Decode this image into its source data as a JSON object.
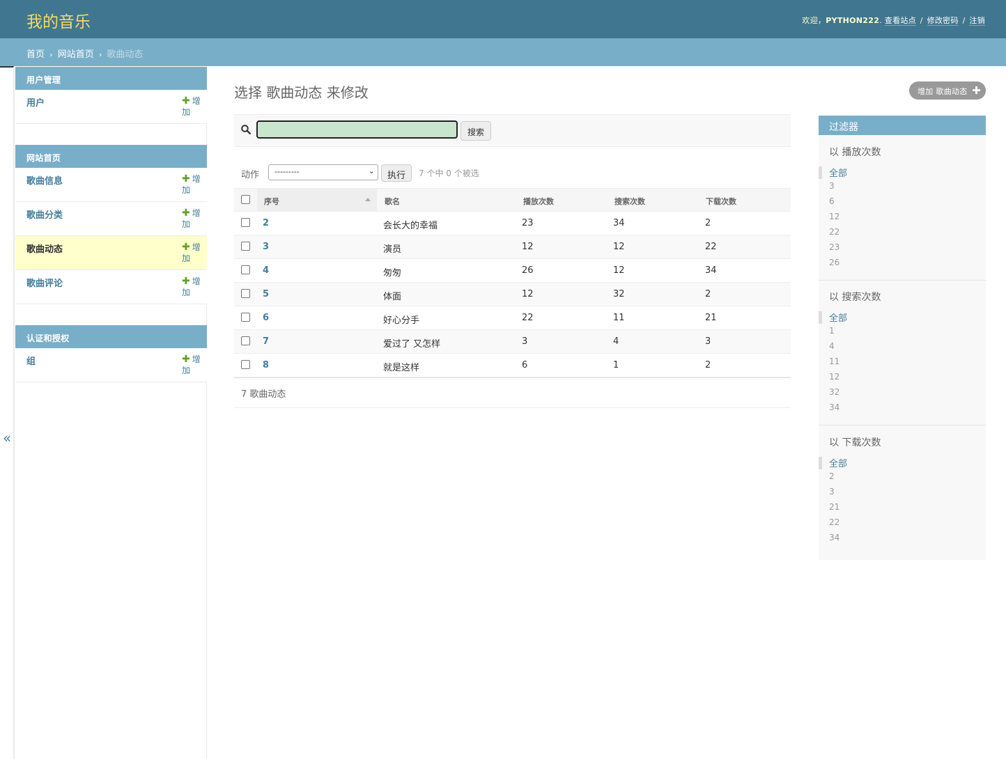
{
  "header": {
    "brand": "我的音乐",
    "welcome": "欢迎，",
    "username": "PYTHON222",
    "period": ".",
    "view_site": "查看站点",
    "change_password": "修改密码",
    "logout": "注销",
    "separator": "/"
  },
  "breadcrumbs": {
    "home": "首页",
    "app": "网站首页",
    "current": "歌曲动态",
    "sep": "›"
  },
  "sidebar": {
    "toggle": "«",
    "add_label": "增加",
    "modules": [
      {
        "caption": "用户管理",
        "items": [
          {
            "label": "用户"
          }
        ]
      },
      {
        "caption": "网站首页",
        "items": [
          {
            "label": "歌曲信息"
          },
          {
            "label": "歌曲分类"
          },
          {
            "label": "歌曲动态"
          },
          {
            "label": "歌曲评论"
          }
        ]
      },
      {
        "caption": "认证和授权",
        "items": [
          {
            "label": "组"
          }
        ]
      }
    ]
  },
  "main": {
    "title": "选择 歌曲动态 来修改",
    "add_button": "增加 歌曲动态",
    "search_value": "",
    "search_button": "搜索",
    "action_label": "动作",
    "action_selected": "---------",
    "go_button": "执行",
    "action_counter": "7 个中 0 个被选",
    "columns": [
      "序号",
      "歌名",
      "播放次数",
      "搜索次数",
      "下载次数"
    ],
    "rows": [
      {
        "id": "2",
        "name": "会长大的幸福",
        "plays": "23",
        "searches": "34",
        "downloads": "2"
      },
      {
        "id": "3",
        "name": "演员",
        "plays": "12",
        "searches": "12",
        "downloads": "22"
      },
      {
        "id": "4",
        "name": "匆匆",
        "plays": "26",
        "searches": "12",
        "downloads": "34"
      },
      {
        "id": "5",
        "name": "体面",
        "plays": "12",
        "searches": "32",
        "downloads": "2"
      },
      {
        "id": "6",
        "name": "好心分手",
        "plays": "22",
        "searches": "11",
        "downloads": "21"
      },
      {
        "id": "7",
        "name": "爱过了 又怎样",
        "plays": "3",
        "searches": "4",
        "downloads": "3"
      },
      {
        "id": "8",
        "name": "就是这样",
        "plays": "6",
        "searches": "1",
        "downloads": "2"
      }
    ],
    "paginator": "7 歌曲动态"
  },
  "filter": {
    "title": "过滤器",
    "groups": [
      {
        "heading": "以 播放次数",
        "options": [
          "全部",
          "3",
          "6",
          "12",
          "22",
          "23",
          "26"
        ]
      },
      {
        "heading": "以 搜索次数",
        "options": [
          "全部",
          "1",
          "4",
          "11",
          "12",
          "32",
          "34"
        ]
      },
      {
        "heading": "以 下载次数",
        "options": [
          "全部",
          "2",
          "3",
          "21",
          "22",
          "34"
        ]
      }
    ]
  },
  "colors": {
    "header_bg": "#417690",
    "brand": "#f5dd5d",
    "breadcrumb_bg": "#79aec8",
    "link": "#447e9b",
    "current_row_bg": "#ffffcc",
    "add_icon": "#5fa225",
    "search_bg": "#c8e6cd"
  },
  "icons": {
    "search": "search-icon",
    "add": "plus-icon",
    "toggle": "collapse-sidebar-icon"
  }
}
